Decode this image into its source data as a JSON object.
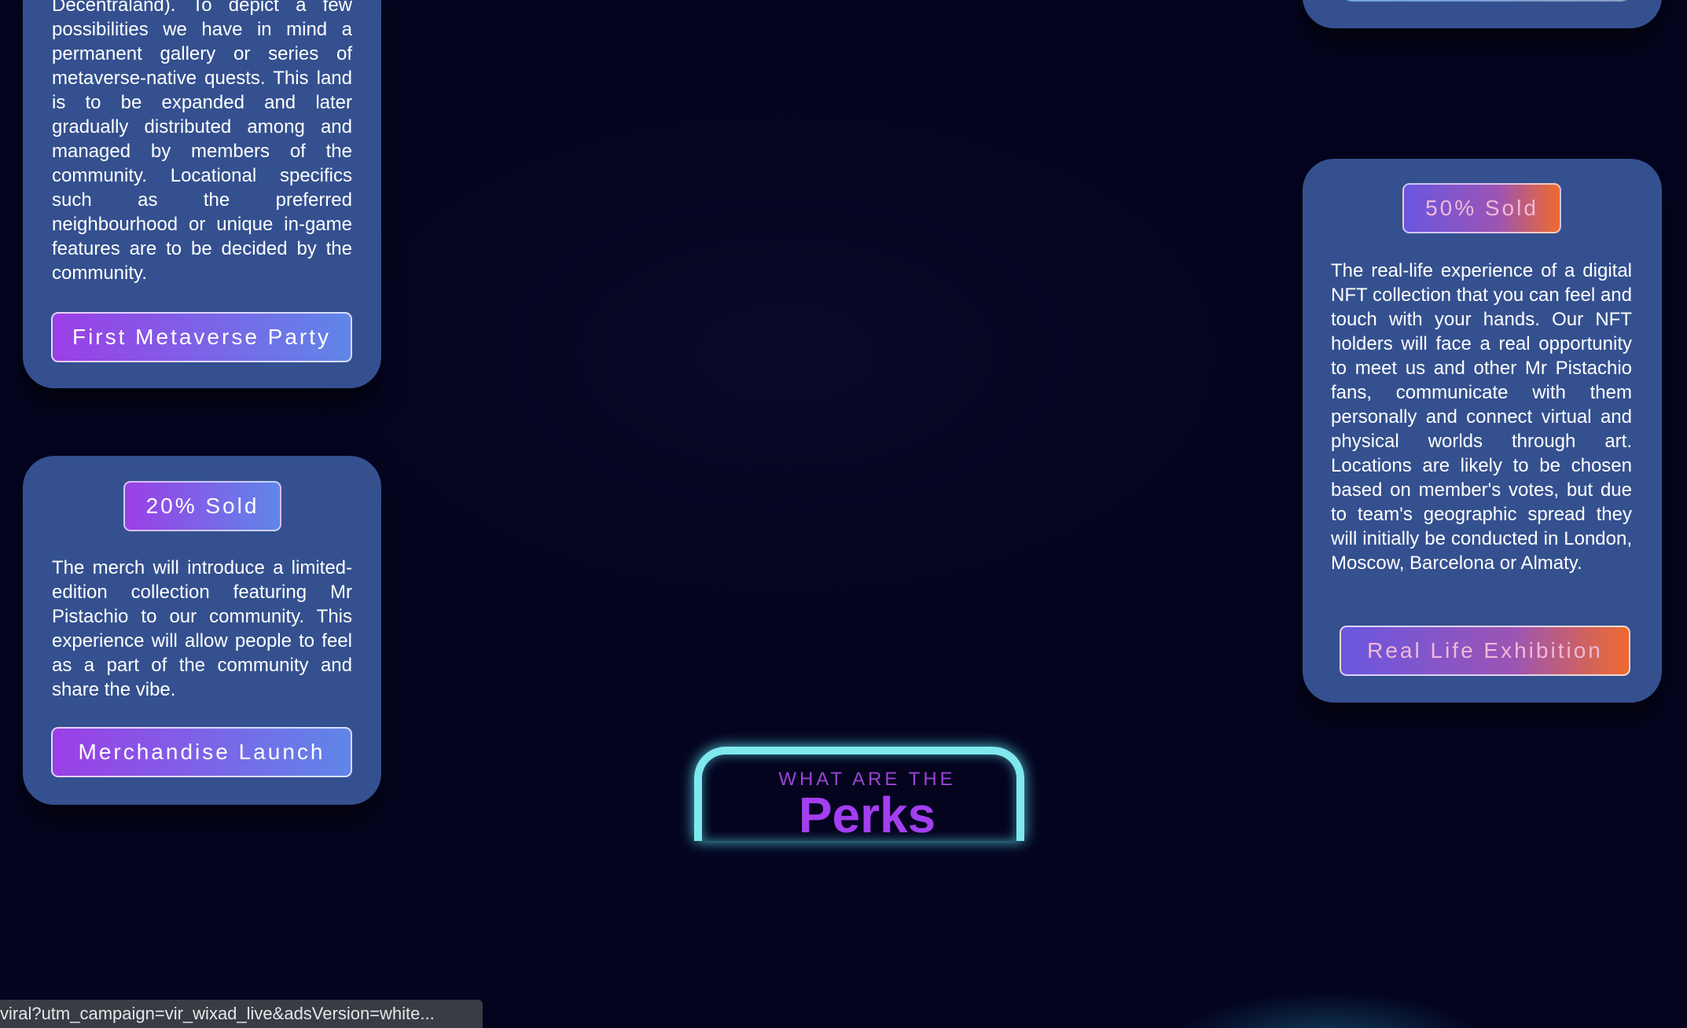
{
  "cards": {
    "metaverse": {
      "text": "Decentraland). To depict a few possibilities we have in mind a permanent gallery or series of metaverse-native quests. This land is to be expanded and later gradually distributed among and managed by members of the community. Locational specifics such as the preferred neighbourhood or unique in-game features are to be decided by the community.",
      "button": "First Metaverse Party"
    },
    "merch": {
      "badge": "20% Sold",
      "text": "The merch will introduce a limited-edition collection featuring Mr Pistachio to our community. This experience will allow people to feel as a part of the community and share the vibe.",
      "button": "Merchandise Launch"
    },
    "exhibition": {
      "badge": "50% Sold",
      "text": "The real-life experience of a digital NFT collection that you can feel and touch with your hands. Our NFT holders will face a real opportunity to meet us and other Mr Pistachio fans, communicate with them personally and connect virtual and physical worlds through art. Locations are likely to be chosen based on member's votes, but due to team's geographic spread they will initially be conducted in London, Moscow, Barcelona or Almaty.",
      "button": "Real Life Exhibition"
    }
  },
  "perks": {
    "small": "WHAT ARE THE",
    "big": "Perks"
  },
  "status_bar": {
    "url": "viral?utm_campaign=vir_wixad_live&adsVersion=white..."
  },
  "colors": {
    "background": "#04041f",
    "card": "#34508f",
    "neon": "#7fe8ef",
    "accent_purple": "#a33ff0"
  }
}
